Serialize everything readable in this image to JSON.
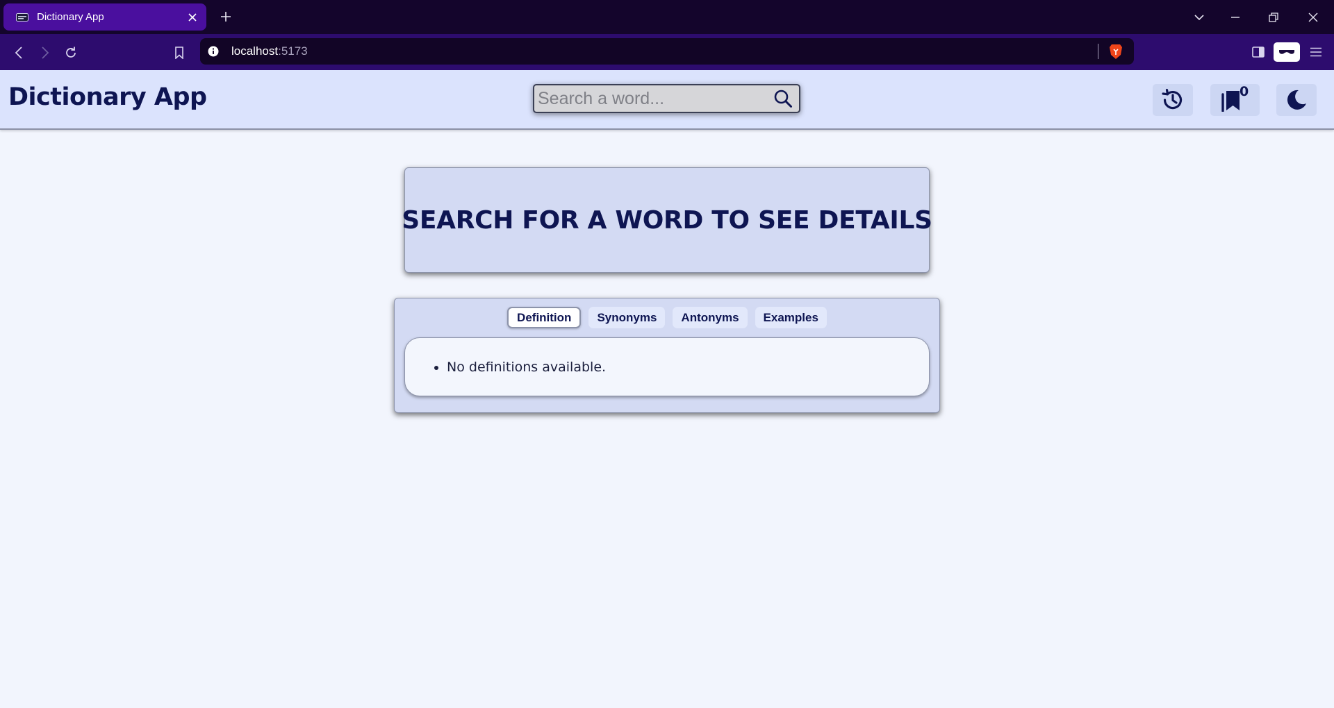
{
  "browser": {
    "tab_title": "Dictionary App",
    "address_host": "localhost",
    "address_port": ":5173"
  },
  "app": {
    "title": "Dictionary App",
    "search_placeholder": "Search a word...",
    "bookmark_count": "0"
  },
  "main": {
    "heading": "SEARCH FOR A WORD TO SEE DETAILS",
    "tabs": [
      {
        "label": "Definition",
        "active": true
      },
      {
        "label": "Synonyms",
        "active": false
      },
      {
        "label": "Antonyms",
        "active": false
      },
      {
        "label": "Examples",
        "active": false
      }
    ],
    "definitions": [
      "No definitions available."
    ]
  },
  "icons": {
    "history": "history-icon",
    "bookmarks": "bookmarks-icon",
    "theme": "moon-icon",
    "search": "search-icon"
  },
  "colors": {
    "primary_text": "#0e1552",
    "header_bg": "#dbe3fd",
    "card_bg": "#d3daf3",
    "page_bg": "#f2f5fd"
  }
}
